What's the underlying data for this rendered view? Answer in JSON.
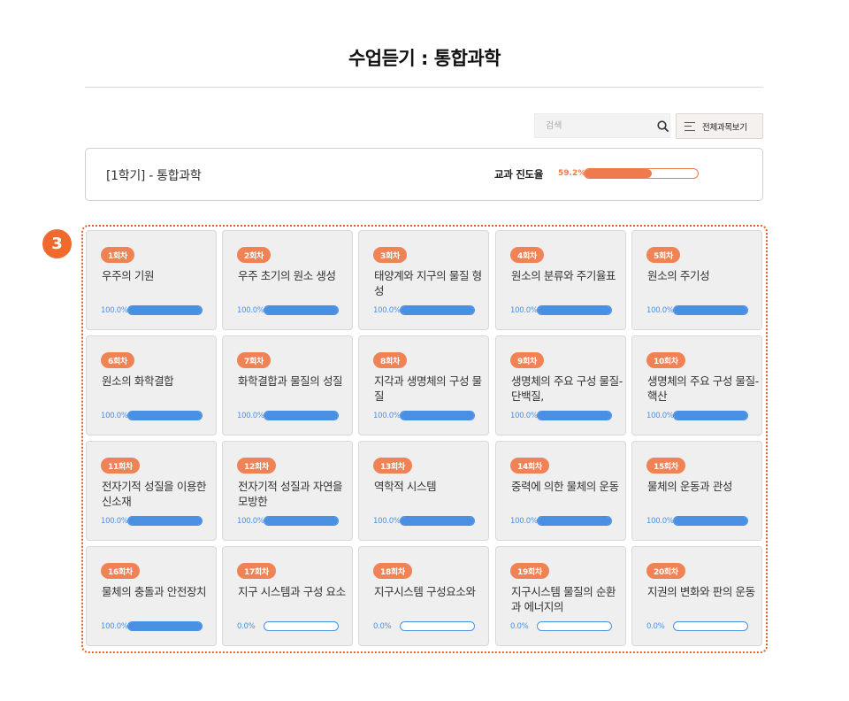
{
  "page": {
    "title": "수업듣기 : 통합과학"
  },
  "search": {
    "placeholder": "검색"
  },
  "all_button": {
    "label": "전체과목보기"
  },
  "course": {
    "name": "[1학기] - 통합과학",
    "progress_label": "교과 진도율",
    "progress_pct_text": "59.2%",
    "progress_value": 59.2
  },
  "annotation": {
    "number": "3"
  },
  "colors": {
    "accent_orange": "#ef8356",
    "progress_blue": "#4a90e2",
    "badge_orange": "#ef6a2c"
  },
  "lessons": [
    {
      "chip": "1회차",
      "title": "우주의 기원",
      "pct_text": "100.0%",
      "pct": 100
    },
    {
      "chip": "2회차",
      "title": "우주 초기의 원소 생성",
      "pct_text": "100.0%",
      "pct": 100
    },
    {
      "chip": "3회차",
      "title": "태양계와 지구의 물질 형성",
      "pct_text": "100.0%",
      "pct": 100
    },
    {
      "chip": "4회차",
      "title": "원소의 분류와 주기율표",
      "pct_text": "100.0%",
      "pct": 100
    },
    {
      "chip": "5회차",
      "title": "원소의 주기성",
      "pct_text": "100.0%",
      "pct": 100
    },
    {
      "chip": "6회차",
      "title": "원소의 화학결합",
      "pct_text": "100.0%",
      "pct": 100
    },
    {
      "chip": "7회차",
      "title": "화학결합과 물질의 성질",
      "pct_text": "100.0%",
      "pct": 100
    },
    {
      "chip": "8회차",
      "title": "지각과 생명체의 구성 물질",
      "pct_text": "100.0%",
      "pct": 100
    },
    {
      "chip": "9회차",
      "title": "생명체의 주요 구성 물질-단백질,",
      "pct_text": "100.0%",
      "pct": 100
    },
    {
      "chip": "10회차",
      "title": "생명체의 주요 구성 물질-핵산",
      "pct_text": "100.0%",
      "pct": 100
    },
    {
      "chip": "11회차",
      "title": "전자기적 성질을 이용한 신소재",
      "pct_text": "100.0%",
      "pct": 100
    },
    {
      "chip": "12회차",
      "title": "전자기적 성질과 자연을 모방한",
      "pct_text": "100.0%",
      "pct": 100
    },
    {
      "chip": "13회차",
      "title": "역학적 시스템",
      "pct_text": "100.0%",
      "pct": 100
    },
    {
      "chip": "14회차",
      "title": "중력에 의한 물체의 운동",
      "pct_text": "100.0%",
      "pct": 100
    },
    {
      "chip": "15회차",
      "title": "물체의 운동과 관성",
      "pct_text": "100.0%",
      "pct": 100
    },
    {
      "chip": "16회차",
      "title": "물체의 충돌과 안전장치",
      "pct_text": "100.0%",
      "pct": 100
    },
    {
      "chip": "17회차",
      "title": "지구 시스템과 구성 요소",
      "pct_text": "0.0%",
      "pct": 0
    },
    {
      "chip": "18회차",
      "title": "지구시스템 구성요소와",
      "pct_text": "0.0%",
      "pct": 0
    },
    {
      "chip": "19회차",
      "title": "지구시스템 물질의 순환과 에너지의",
      "pct_text": "0.0%",
      "pct": 0
    },
    {
      "chip": "20회차",
      "title": "지권의 변화와 판의 운동",
      "pct_text": "0.0%",
      "pct": 0
    }
  ]
}
